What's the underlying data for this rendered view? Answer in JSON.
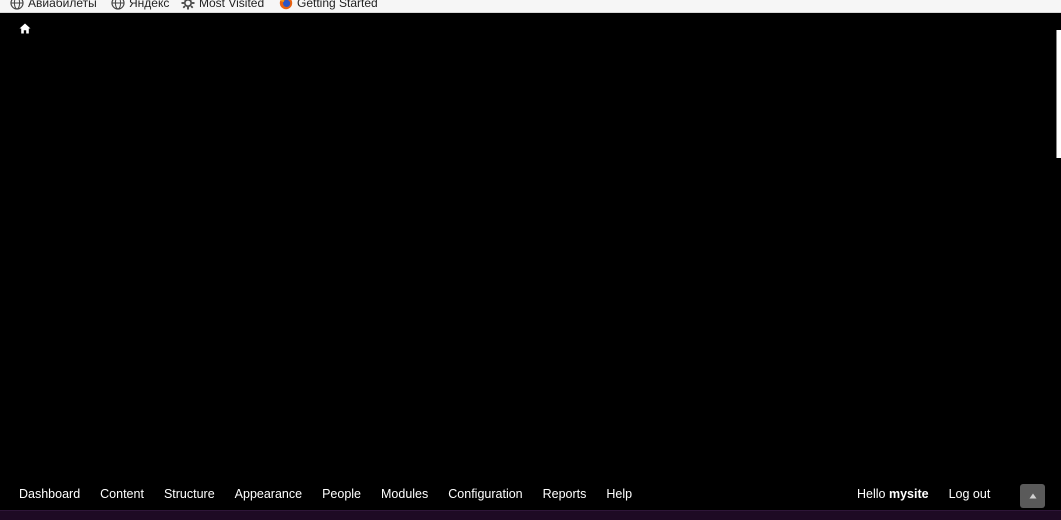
{
  "bookmarks": {
    "items": [
      {
        "label": "Авиабилеты",
        "icon": "globe-icon"
      },
      {
        "label": "Яндекс",
        "icon": "globe-icon"
      },
      {
        "label": "Most Visited",
        "icon": "gear-icon"
      },
      {
        "label": "Getting Started",
        "icon": "firefox-icon"
      }
    ]
  },
  "toolbar": {
    "home_icon": "home-icon",
    "menu": [
      {
        "label": "Dashboard"
      },
      {
        "label": "Content"
      },
      {
        "label": "Structure"
      },
      {
        "label": "Appearance"
      },
      {
        "label": "People"
      },
      {
        "label": "Modules"
      },
      {
        "label": "Configuration"
      },
      {
        "label": "Reports"
      },
      {
        "label": "Help"
      }
    ],
    "greeting_prefix": "Hello",
    "username": "mysite",
    "logout_label": "Log out",
    "toggle_icon": "triangle-up-icon"
  },
  "colors": {
    "background": "#000000",
    "toolbar_text": "#ffffff",
    "toggle_button": "#5a5a5a",
    "bottom_strip": "#1e0a24"
  }
}
